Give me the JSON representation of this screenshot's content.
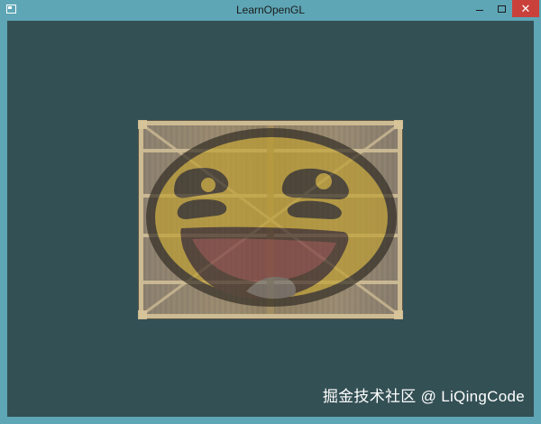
{
  "window": {
    "title": "LearnOpenGL",
    "close_glyph": "✕"
  },
  "canvas": {
    "background_color": "#335055"
  },
  "watermark": {
    "text": "掘金技术社区 @ LiQingCode"
  },
  "icons": {
    "app": "window-app-icon",
    "minimize": "minimize-icon",
    "maximize": "maximize-icon",
    "close": "close-icon"
  }
}
